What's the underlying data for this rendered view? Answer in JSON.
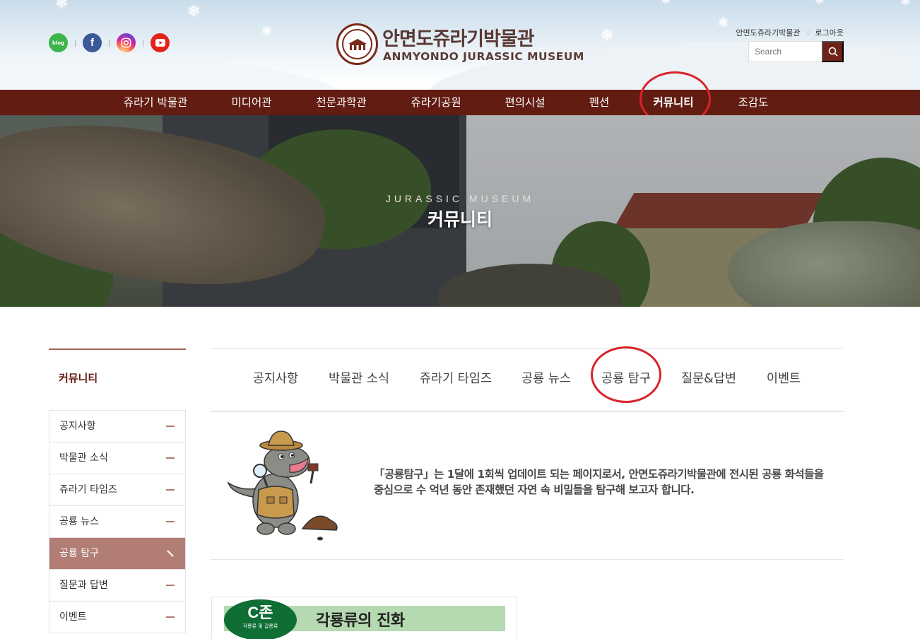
{
  "header": {
    "logo_ko": "안면도쥬라기박물관",
    "logo_en": "ANMYONDO JURASSIC MUSEUM",
    "util_links": [
      "안면도쥬라기박물관",
      "로그아웃"
    ],
    "search_placeholder": "Search",
    "sns": [
      {
        "icon": "blog-icon",
        "text": "blog",
        "color": "#3cb54a"
      },
      {
        "icon": "facebook-icon",
        "text": "f",
        "color": "#3b5998"
      },
      {
        "icon": "instagram-icon",
        "color": "#d6249f"
      },
      {
        "icon": "youtube-icon",
        "color": "#e62117"
      }
    ]
  },
  "nav": {
    "items": [
      "쥬라기 박물관",
      "미디어관",
      "천문과학관",
      "쥬라기공원",
      "편의시설",
      "펜션",
      "커뮤니티",
      "조감도"
    ],
    "active": "커뮤니티",
    "bg_color": "#621c12"
  },
  "visual": {
    "subtitle": "JURASSIC MUSEUM",
    "title": "커뮤니티"
  },
  "lnb": {
    "title": "커뮤니티",
    "items": [
      "공지사항",
      "박물관 소식",
      "쥬라기 타임즈",
      "공룡 뉴스",
      "공룡 탐구",
      "질문과 답변",
      "이벤트"
    ],
    "active": "공룡 탐구",
    "active_color": "#b27d74"
  },
  "tabs": {
    "items": [
      "공지사항",
      "박물관 소식",
      "쥬라기 타임즈",
      "공룡 뉴스",
      "공룡 탐구",
      "질문&답변",
      "이벤트"
    ],
    "active": "공룡 탐구"
  },
  "intro": {
    "line1": "「공룡탐구」는 1달에 1회씩 업데이트 되는 페이지로서, 안면도쥬라기박물관에 전시된 공룡 화석들을",
    "line2": "중심으로 수 억년 동안 존재했던 자연 속 비밀들을 탐구해 보고자 합니다."
  },
  "article": {
    "zone": "C존",
    "zone_sub": "각룡류 및 갑룡류",
    "title": "각룡류의 진화"
  },
  "highlight_color": "#d9232a"
}
